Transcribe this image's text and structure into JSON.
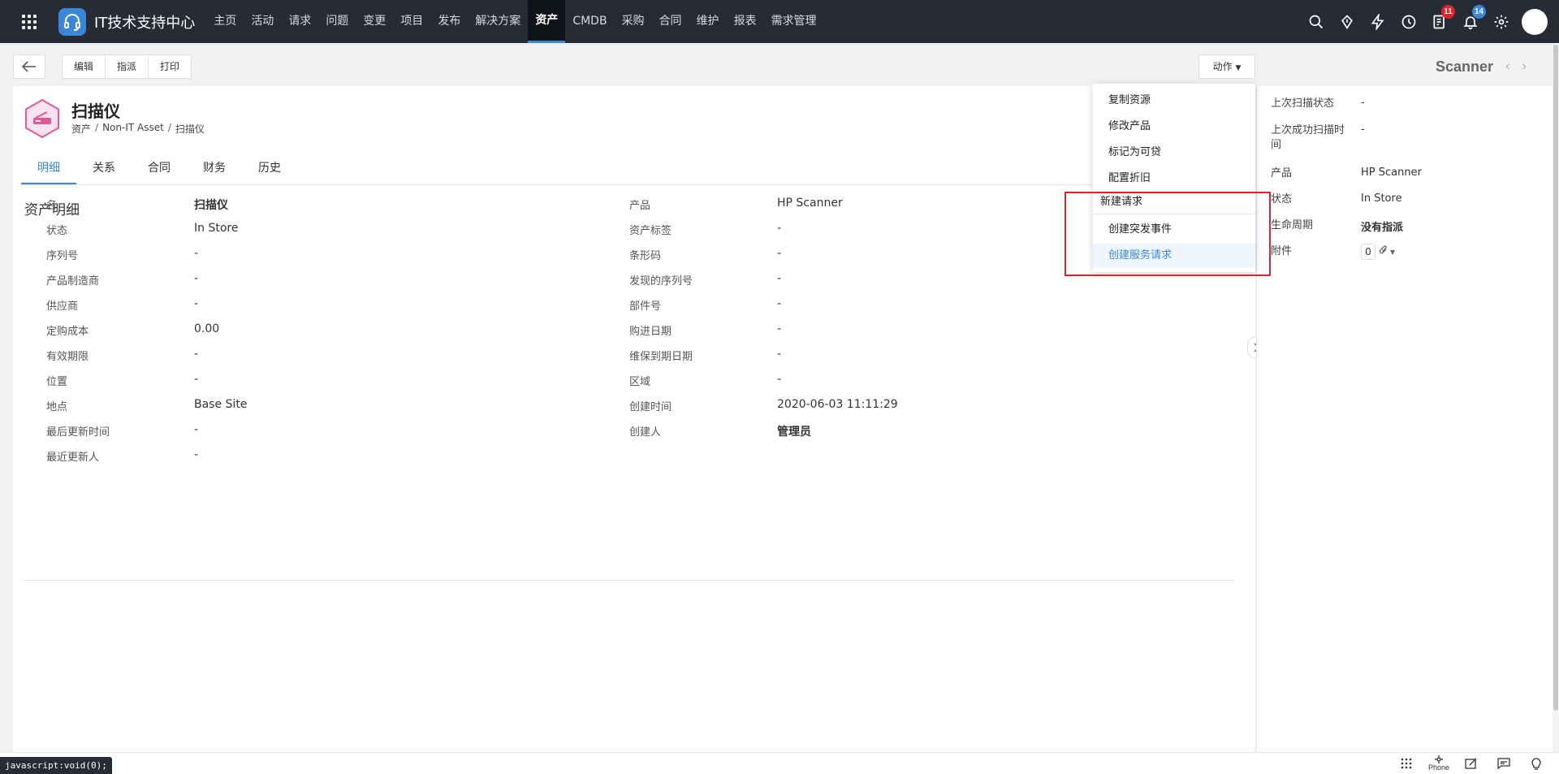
{
  "app": {
    "title": "IT技术支持中心"
  },
  "nav": {
    "menu": [
      "主页",
      "活动",
      "请求",
      "问题",
      "变更",
      "项目",
      "发布",
      "解决方案",
      "资产",
      "CMDB",
      "采购",
      "合同",
      "维护",
      "报表",
      "需求管理"
    ],
    "active_index": 8,
    "badges": {
      "tasks": "11",
      "notifications": "14"
    }
  },
  "toolbar": {
    "edit": "编辑",
    "assign": "指派",
    "print": "打印",
    "actions": "动作"
  },
  "pager": {
    "title": "Scanner"
  },
  "asset": {
    "title": "扫描仪",
    "breadcrumb": [
      "资产",
      "Non-IT Asset",
      "扫描仪"
    ]
  },
  "tabs": [
    "明细",
    "关系",
    "合同",
    "财务",
    "历史"
  ],
  "section": {
    "title": "资产明细"
  },
  "fields_left": [
    {
      "label": "名",
      "value": "扫描仪",
      "bold": true
    },
    {
      "label": "状态",
      "value": "In Store",
      "bold": false
    },
    {
      "label": "序列号",
      "value": "-",
      "bold": false
    },
    {
      "label": "产品制造商",
      "value": "-",
      "bold": false
    },
    {
      "label": "供应商",
      "value": "-",
      "bold": false
    },
    {
      "label": "定购成本",
      "value": "0.00",
      "bold": false
    },
    {
      "label": "有效期限",
      "value": "-",
      "bold": false
    },
    {
      "label": "位置",
      "value": "-",
      "bold": false
    },
    {
      "label": "地点",
      "value": "Base Site",
      "bold": false
    },
    {
      "label": "最后更新时间",
      "value": "-",
      "bold": false
    },
    {
      "label": "最近更新人",
      "value": "-",
      "bold": false
    }
  ],
  "fields_right": [
    {
      "label": "产品",
      "value": "HP Scanner",
      "bold": false
    },
    {
      "label": "资产标签",
      "value": "-",
      "bold": false
    },
    {
      "label": "条形码",
      "value": "-",
      "bold": false
    },
    {
      "label": "发现的序列号",
      "value": "-",
      "bold": false
    },
    {
      "label": "部件号",
      "value": "-",
      "bold": false
    },
    {
      "label": "购进日期",
      "value": "-",
      "bold": false
    },
    {
      "label": "维保到期日期",
      "value": "-",
      "bold": false
    },
    {
      "label": "区域",
      "value": "-",
      "bold": false
    },
    {
      "label": "创建时间",
      "value": "2020-06-03 11:11:29",
      "bold": false
    },
    {
      "label": "创建人",
      "value": "管理员",
      "bold": true
    }
  ],
  "right_panel": [
    {
      "label": "上次扫描状态",
      "value": "-"
    },
    {
      "label": "上次成功扫描时间",
      "value": "-"
    },
    {
      "label": "产品",
      "value": "HP Scanner"
    },
    {
      "label": "状态",
      "value": "In Store"
    },
    {
      "label": "生命周期",
      "value": "没有指派"
    },
    {
      "label": "附件",
      "value": "0"
    }
  ],
  "dropdown": {
    "items_top": [
      "复制资源",
      "修改产品",
      "标记为可贷",
      "配置折旧"
    ],
    "header": "新建请求",
    "items_bottom": [
      "创建突发事件",
      "创建服务请求"
    ]
  },
  "statusbar": {
    "url": "javascript:void(0);",
    "phone": "Phone"
  },
  "colors": {
    "accent": "#3b86d8",
    "nav_bg": "#262b35",
    "highlight": "#e0222c",
    "asset_icon": "#e05a9a"
  }
}
